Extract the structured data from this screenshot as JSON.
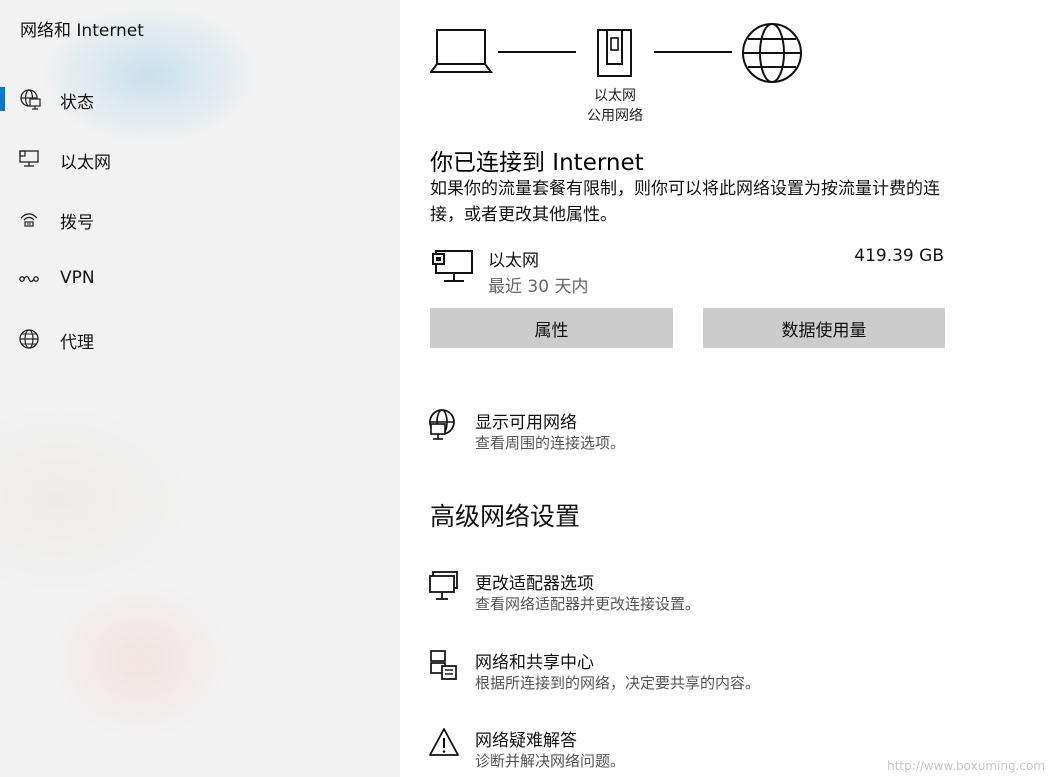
{
  "app": {
    "title": "网络和 Internet"
  },
  "sidebar": {
    "items": [
      {
        "label": "状态",
        "icon": "status-globe-icon",
        "selected": true
      },
      {
        "label": "以太网",
        "icon": "ethernet-icon",
        "selected": false
      },
      {
        "label": "拨号",
        "icon": "dialup-icon",
        "selected": false
      },
      {
        "label": "VPN",
        "icon": "vpn-icon",
        "selected": false
      },
      {
        "label": "代理",
        "icon": "globe-icon",
        "selected": false
      }
    ]
  },
  "diagram": {
    "adapter_name": "以太网",
    "network_type": "公用网络"
  },
  "status": {
    "heading": "你已连接到 Internet",
    "description": "如果你的流量套餐有限制，则你可以将此网络设置为按流量计费的连接，或者更改其他属性。"
  },
  "connection": {
    "name": "以太网",
    "period": "最近 30 天内",
    "usage": "419.39 GB"
  },
  "buttons": {
    "properties": "属性",
    "data_usage": "数据使用量"
  },
  "show_networks": {
    "title": "显示可用网络",
    "subtitle": "查看周围的连接选项。"
  },
  "advanced": {
    "heading": "高级网络设置",
    "links": [
      {
        "title": "更改适配器选项",
        "subtitle": "查看网络适配器并更改连接设置。",
        "icon": "adapter-icon"
      },
      {
        "title": "网络和共享中心",
        "subtitle": "根据所连接到的网络，决定要共享的内容。",
        "icon": "sharing-center-icon"
      },
      {
        "title": "网络疑难解答",
        "subtitle": "诊断并解决网络问题。",
        "icon": "warning-icon"
      }
    ]
  },
  "watermark": "http://www.boxuming.com",
  "colors": {
    "accent": "#0078d7",
    "button_bg": "#cccccc",
    "sidebar_bg": "#f2f2f2"
  }
}
